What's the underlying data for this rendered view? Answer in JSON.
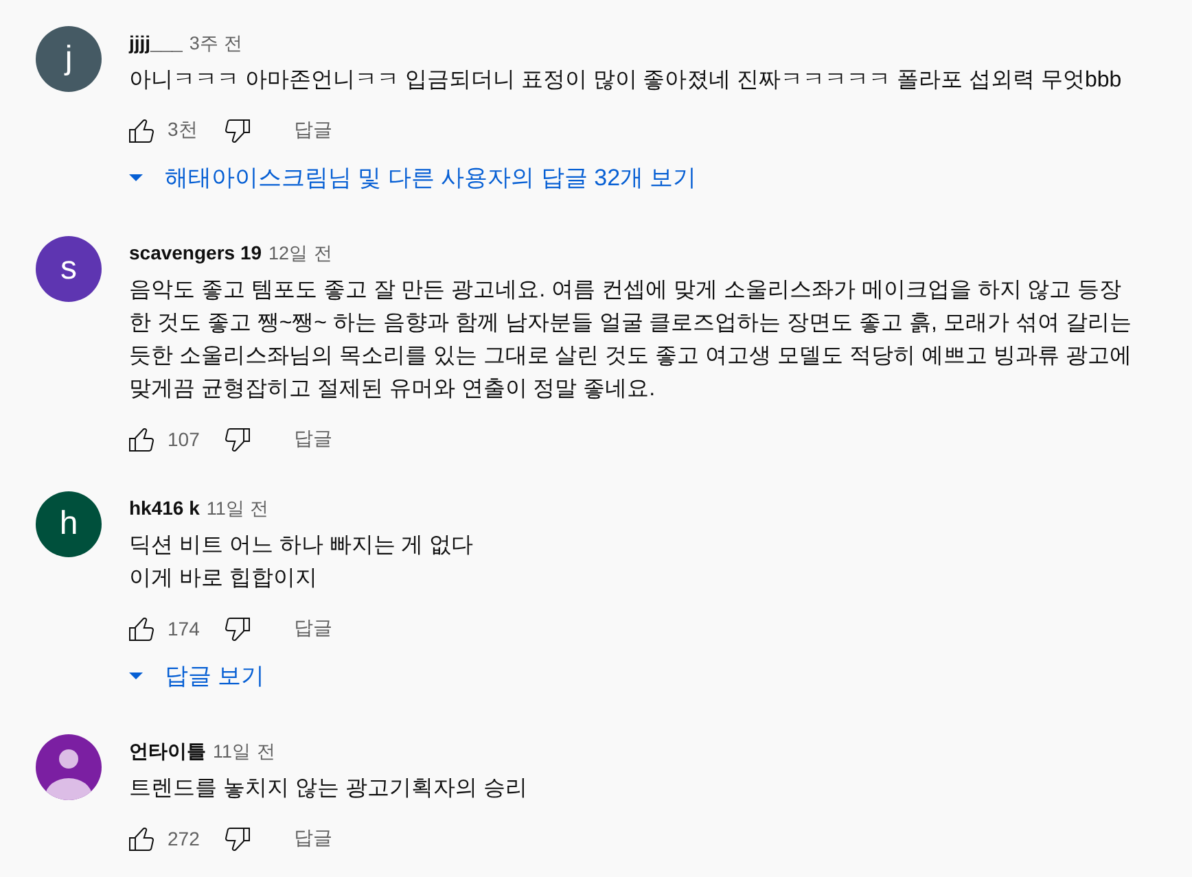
{
  "comments": [
    {
      "avatar": {
        "kind": "letter",
        "letter": "j",
        "color": "#455a64"
      },
      "author": "jjjj___",
      "time": "3주 전",
      "text": "아니ㅋㅋㅋ 아마존언니ㅋㅋ 입금되더니 표정이 많이 좋아졌네 진짜ㅋㅋㅋㅋㅋ 폴라포 섭외력 무엇bbb",
      "likes": "3천",
      "reply_label": "답글",
      "replies_link": "해태아이스크림님 및 다른 사용자의 답글 32개 보기"
    },
    {
      "avatar": {
        "kind": "letter",
        "letter": "s",
        "color": "#5e35b1"
      },
      "author": "scavengers 19",
      "time": "12일 전",
      "text": "음악도 좋고 템포도 좋고 잘 만든 광고네요. 여름 컨셉에 맞게 소울리스좌가 메이크업을 하지 않고 등장한 것도 좋고 쨍~쨍~ 하는 음향과 함께 남자분들 얼굴 클로즈업하는 장면도 좋고 흙, 모래가 섞여 갈리는 듯한 소울리스좌님의 목소리를 있는 그대로 살린 것도 좋고 여고생 모델도 적당히 예쁘고 빙과류 광고에 맞게끔 균형잡히고 절제된 유머와 연출이 정말 좋네요.",
      "likes": "107",
      "reply_label": "답글"
    },
    {
      "avatar": {
        "kind": "letter",
        "letter": "h",
        "color": "#00503c"
      },
      "author": "hk416 k",
      "time": "11일 전",
      "text": "딕션 비트 어느 하나 빠지는 게 없다\n이게 바로 힙합이지",
      "likes": "174",
      "reply_label": "답글",
      "replies_link": "답글 보기"
    },
    {
      "avatar": {
        "kind": "silhouette",
        "color": "#7b1fa2"
      },
      "author": "언타이틀",
      "time": "11일 전",
      "text": "트렌드를 놓치지 않는 광고기획자의 승리",
      "likes": "272",
      "reply_label": "답글"
    }
  ]
}
